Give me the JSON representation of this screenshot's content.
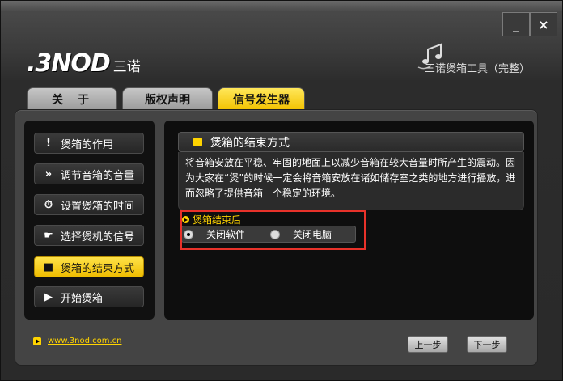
{
  "window": {
    "minimize_glyph": "_",
    "close_glyph": "×"
  },
  "logo": {
    "mark": ".3NOD",
    "cn": "三诺"
  },
  "app_title": "三诺煲箱工具（完整）",
  "tabs": [
    {
      "label": "关于"
    },
    {
      "label": "版权声明"
    },
    {
      "label": "信号发生器",
      "active": true
    }
  ],
  "sidebar": {
    "items": [
      {
        "label": "煲箱的作用",
        "icon": "!"
      },
      {
        "label": "调节音箱的音量",
        "icon": "»"
      },
      {
        "label": "设置煲箱的时间",
        "icon": "⏱"
      },
      {
        "label": "选择煲机的信号",
        "icon": "☛"
      },
      {
        "label": "煲箱的结束方式",
        "icon": "■",
        "active": true
      },
      {
        "label": "开始煲箱",
        "icon": "▶"
      }
    ]
  },
  "content": {
    "heading": "煲箱的结束方式",
    "description": "将音箱安放在平稳、牢固的地面上以减少音箱在较大音量时所产生的震动。因为大家在“煲”的时候一定会将音箱安放在诸如储存室之类的地方进行播放，进而忽略了提供音箱一个稳定的环境。",
    "ending_label": "煲箱结束后",
    "options": [
      {
        "label": "关闭软件",
        "checked": true
      },
      {
        "label": "关闭电脑",
        "checked": false
      }
    ]
  },
  "footer": {
    "link": "www.3nod.com.cn",
    "prev_label": "上一步",
    "next_label": "下一步"
  },
  "colors": {
    "accent": "#ffd400",
    "highlight_box": "#e8322a"
  }
}
